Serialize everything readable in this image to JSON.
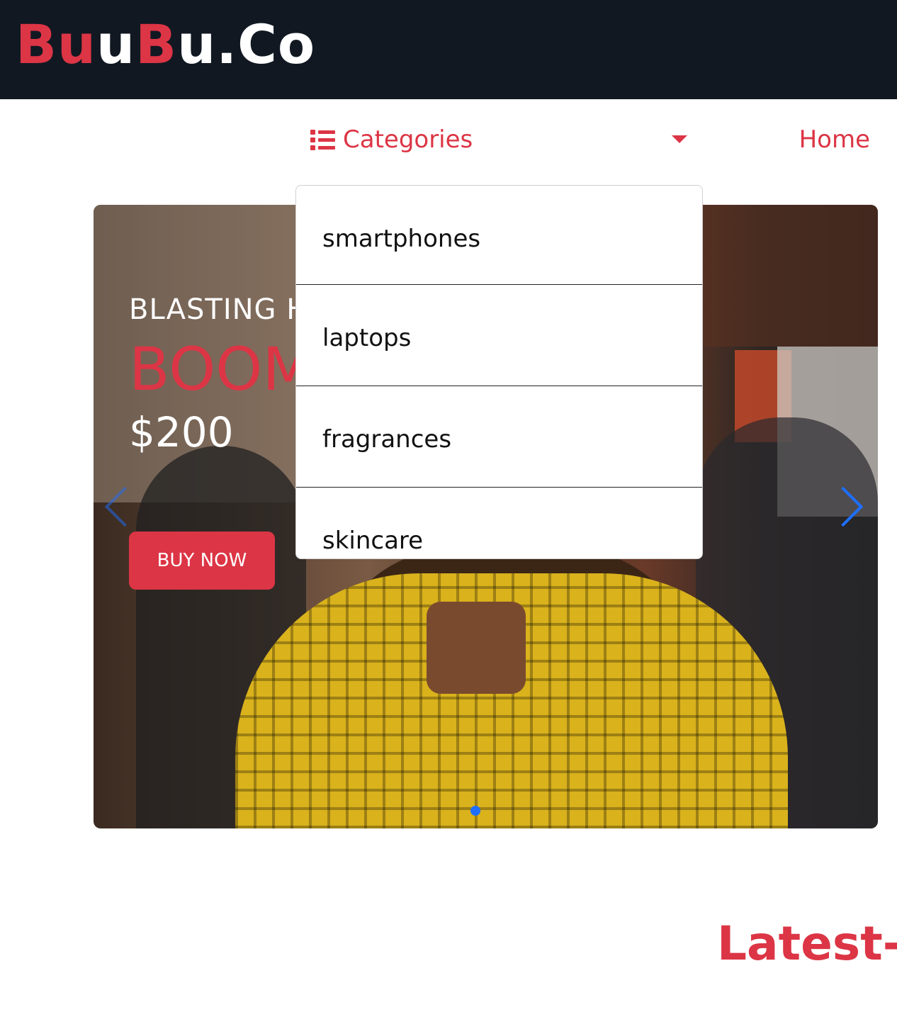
{
  "brand": {
    "part1": "Bu",
    "part2": "Bu",
    "part3": "u.Co",
    "accent": "#dc3545",
    "header_bg": "#111822"
  },
  "nav": {
    "categories_label": "Categories",
    "categories_icon": "list-icon",
    "caret_icon": "caret-down-icon",
    "home_label": "Home"
  },
  "dropdown": {
    "items": [
      "smartphones",
      "laptops",
      "fragrances",
      "skincare"
    ]
  },
  "hero": {
    "subtitle": "BLASTING H",
    "title": "BOOM",
    "price": "$200",
    "button_label": "BUY NOW",
    "prev_icon": "chevron-left-icon",
    "next_icon": "chevron-right-icon",
    "indicator_color": "#1e6fff"
  },
  "section": {
    "heading": "Latest-"
  }
}
